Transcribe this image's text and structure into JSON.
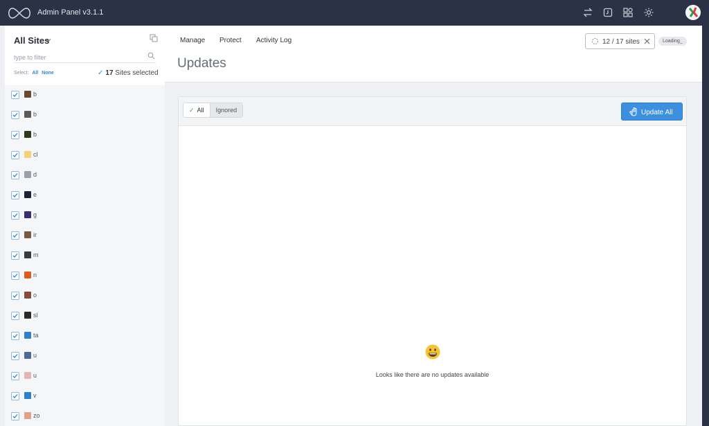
{
  "app": {
    "title": "Admin Panel v3.1.1"
  },
  "topbar_icons": [
    "transfer-icon",
    "refresh-icon",
    "apps-icon",
    "settings-icon"
  ],
  "sidebar": {
    "title": "All Sites",
    "filter_placeholder": "type to filter",
    "select_label": "Select:",
    "select_all": "All",
    "select_none": "None",
    "selected_count": "17",
    "selected_suffix": "Sites selected",
    "sites": [
      {
        "name": "b",
        "color": "#6b4b2e"
      },
      {
        "name": "b",
        "color": "#5a5a5a"
      },
      {
        "name": "b",
        "color": "#2d3a1c"
      },
      {
        "name": "cl",
        "color": "#f3d27a"
      },
      {
        "name": "d",
        "color": "#9aa0aa"
      },
      {
        "name": "e",
        "color": "#1b2233"
      },
      {
        "name": "g",
        "color": "#3b2c6e"
      },
      {
        "name": "ir",
        "color": "#7a5a3e"
      },
      {
        "name": "m",
        "color": "#3a3a3a"
      },
      {
        "name": "n",
        "color": "#e05a1a"
      },
      {
        "name": "o",
        "color": "#8a4a3a"
      },
      {
        "name": "sl",
        "color": "#2a2a2a"
      },
      {
        "name": "ta",
        "color": "#2f7fcf"
      },
      {
        "name": "u",
        "color": "#4a6a9a"
      },
      {
        "name": "u",
        "color": "#e3b6b6"
      },
      {
        "name": "v",
        "color": "#2f7fcf"
      },
      {
        "name": "zo",
        "color": "#e3a08a"
      }
    ]
  },
  "nav": {
    "manage": "Manage",
    "protect": "Protect",
    "activity_log": "Activity Log"
  },
  "page": {
    "title": "Updates"
  },
  "sites_chip": {
    "label": "12 / 17 sites"
  },
  "loading": "Loading_",
  "filters": {
    "all": "All",
    "ignored": "Ignored"
  },
  "update_button": "Update All",
  "empty": {
    "message": "Looks like there are no updates available"
  }
}
